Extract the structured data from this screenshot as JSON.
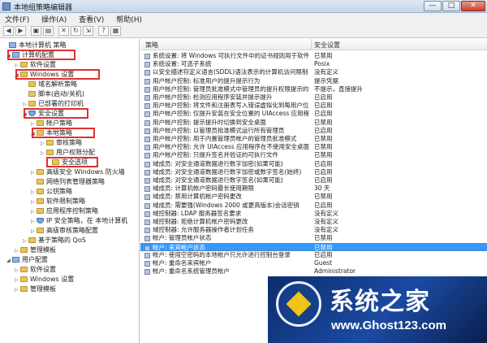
{
  "window": {
    "title": "本地组策略编辑器",
    "minimize": "—",
    "maximize": "□",
    "close": "✕"
  },
  "menu": [
    "文件(F)",
    "操作(A)",
    "查看(V)",
    "帮助(H)"
  ],
  "toolbar": [
    {
      "name": "back-icon",
      "glyph": "◀"
    },
    {
      "name": "forward-icon",
      "glyph": "▶"
    },
    {
      "name": "up-folder-icon",
      "glyph": "▣"
    },
    {
      "name": "show-hide-tree-icon",
      "glyph": "▤"
    },
    {
      "name": "delete-icon",
      "glyph": "✕"
    },
    {
      "name": "refresh-icon",
      "glyph": "↻"
    },
    {
      "name": "export-icon",
      "glyph": "⇲"
    },
    {
      "name": "help-icon",
      "glyph": "?"
    },
    {
      "name": "properties-icon",
      "glyph": "▦"
    }
  ],
  "tree": [
    {
      "label": "本地计算机 策略",
      "icon": "comp",
      "exp": ""
    },
    {
      "label": "计算机配置",
      "icon": "comp",
      "exp": "◢"
    },
    {
      "label": "软件设置",
      "icon": "folder",
      "exp": "▷"
    },
    {
      "label": "Windows 设置",
      "icon": "folder",
      "exp": "◢"
    },
    {
      "label": "域名解析策略",
      "icon": "folder",
      "exp": ""
    },
    {
      "label": "脚本(启动/关机)",
      "icon": "folder",
      "exp": ""
    },
    {
      "label": "已部署的打印机",
      "icon": "folder",
      "exp": "▷"
    },
    {
      "label": "安全设置",
      "icon": "shield",
      "exp": "◢"
    },
    {
      "label": "帐户策略",
      "icon": "folder",
      "exp": "▷"
    },
    {
      "label": "本地策略",
      "icon": "folder",
      "exp": "◢"
    },
    {
      "label": "审核策略",
      "icon": "folder",
      "exp": "▷"
    },
    {
      "label": "用户权限分配",
      "icon": "folder",
      "exp": "▷"
    },
    {
      "label": "安全选项",
      "icon": "folder",
      "exp": ""
    },
    {
      "label": "高级安全 Windows 防火墙",
      "icon": "folder",
      "exp": "▷"
    },
    {
      "label": "网络列表管理器策略",
      "icon": "folder",
      "exp": ""
    },
    {
      "label": "公钥策略",
      "icon": "folder",
      "exp": "▷"
    },
    {
      "label": "软件限制策略",
      "icon": "folder",
      "exp": "▷"
    },
    {
      "label": "应用程序控制策略",
      "icon": "folder",
      "exp": "▷"
    },
    {
      "label": "IP 安全策略，在 本地计算机",
      "icon": "shield",
      "exp": "▷"
    },
    {
      "label": "高级审核策略配置",
      "icon": "folder",
      "exp": "▷"
    },
    {
      "label": "基于策略的 QoS",
      "icon": "folder",
      "exp": "▷"
    },
    {
      "label": "管理模板",
      "icon": "folder",
      "exp": "▷"
    },
    {
      "label": "用户配置",
      "icon": "comp",
      "exp": "◢"
    },
    {
      "label": "软件设置",
      "icon": "folder",
      "exp": "▷"
    },
    {
      "label": "Windows 设置",
      "icon": "folder",
      "exp": "▷"
    },
    {
      "label": "管理模板",
      "icon": "folder",
      "exp": "▷"
    }
  ],
  "list": {
    "headers": {
      "policy": "策略",
      "setting": "安全设置"
    },
    "rows": [
      {
        "policy": "系统设置: 将 Windows 可执行文件中的证书规则用于软件...",
        "setting": "已禁用"
      },
      {
        "policy": "系统设置: 可选子系统",
        "setting": "Posix"
      },
      {
        "policy": "以安全描述符定义语言(SDDL)语法表示的计算机访问限制",
        "setting": "没有定义"
      },
      {
        "policy": "用户帐户控制: 标准用户的提升提示行为",
        "setting": "提示凭据"
      },
      {
        "policy": "用户帐户控制: 管理员批准模式中管理员的提升权限提示的...",
        "setting": "不提示，直接提升"
      },
      {
        "policy": "用户帐户控制: 检测应用程序安装并提示提升",
        "setting": "已启用"
      },
      {
        "policy": "用户帐户控制: 将文件和注册表写入错误虚拟化到每用户位置",
        "setting": "已启用"
      },
      {
        "policy": "用户帐户控制: 仅提升安装在安全位置的 UIAccess 应用程序",
        "setting": "已启用"
      },
      {
        "policy": "用户帐户控制: 提示提升时切换到安全桌面",
        "setting": "已禁用"
      },
      {
        "policy": "用户帐户控制: 以管理员批准模式运行所有管理员",
        "setting": "已启用"
      },
      {
        "policy": "用户帐户控制: 用于内置管理员帐户的管理员批准模式",
        "setting": "已禁用"
      },
      {
        "policy": "用户帐户控制: 允许 UIAccess 应用程序在不使用安全桌面...",
        "setting": "已禁用"
      },
      {
        "policy": "用户帐户控制: 只提升签名并验证的可执行文件",
        "setting": "已禁用"
      },
      {
        "policy": "域成员: 对安全通道数据进行数字加密(如果可能)",
        "setting": "已启用"
      },
      {
        "policy": "域成员: 对安全通道数据进行数字加密或数字签名(始终)",
        "setting": "已启用"
      },
      {
        "policy": "域成员: 对安全通道数据进行数字签名(如果可能)",
        "setting": "已启用"
      },
      {
        "policy": "域成员: 计算机帐户密码最长使用期限",
        "setting": "30 天"
      },
      {
        "policy": "域成员: 禁用计算机帐户密码更改",
        "setting": "已禁用"
      },
      {
        "policy": "域成员: 需要强(Windows 2000 或更高版本)会话密钥",
        "setting": "已启用"
      },
      {
        "policy": "域控制器: LDAP 服务器签名要求",
        "setting": "没有定义"
      },
      {
        "policy": "域控制器: 拒绝计算机帐户密码更改",
        "setting": "没有定义"
      },
      {
        "policy": "域控制器: 允许服务器操作者计划任务",
        "setting": "没有定义"
      },
      {
        "policy": "帐户: 管理员帐户状态",
        "setting": "已禁用"
      },
      {
        "policy": "帐户: 来宾帐户状态",
        "setting": "已禁用",
        "selected": true
      },
      {
        "policy": "帐户: 使用空密码的本地帐户只允许进行控制台登录",
        "setting": "已启用"
      },
      {
        "policy": "帐户: 重命名来宾帐户",
        "setting": "Guest"
      },
      {
        "policy": "帐户: 重命名系统管理员帐户",
        "setting": "Administrator"
      }
    ]
  },
  "watermark": {
    "title": "系统之家",
    "url": "www.Ghost123.com"
  }
}
